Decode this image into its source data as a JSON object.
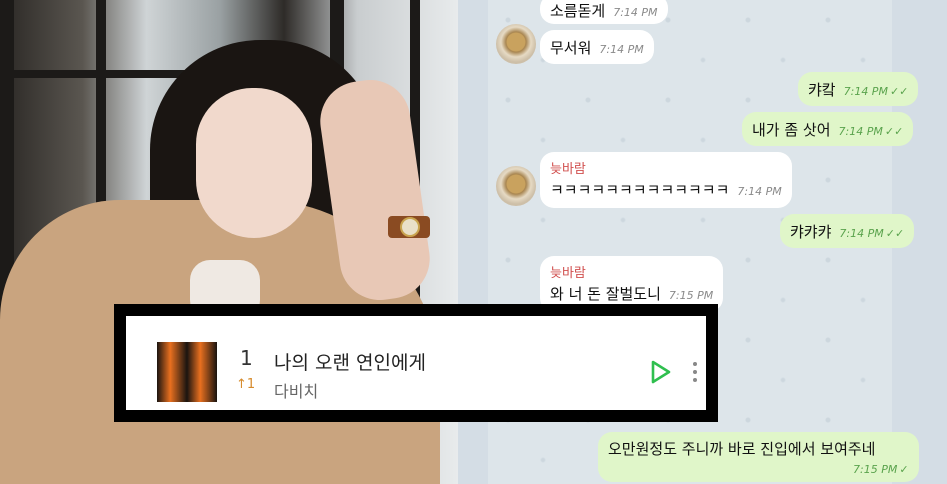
{
  "chat": {
    "messages": [
      {
        "dir": "in",
        "text": "소름돋게",
        "time": "7:14 PM"
      },
      {
        "dir": "in",
        "text": "무서워",
        "time": "7:14 PM"
      },
      {
        "dir": "out",
        "text": "캬캌",
        "time": "7:14 PM"
      },
      {
        "dir": "out",
        "text": "내가 좀 삿어",
        "time": "7:14 PM"
      },
      {
        "dir": "in",
        "sender": "늦바람",
        "text": "ㅋㅋㅋㅋㅋㅋㅋㅋㅋㅋㅋㅋㅋ",
        "time": "7:14 PM"
      },
      {
        "dir": "out",
        "text": "캬캬캬",
        "time": "7:14 PM"
      },
      {
        "dir": "in",
        "sender": "늦바람",
        "text": "와 너 돈 잘벌도니",
        "time": "7:15 PM"
      },
      {
        "dir": "out",
        "text": "오만원정도 주니까 바로 진입에서 보여주네",
        "time": "7:15 PM"
      }
    ]
  },
  "player": {
    "rank": "1",
    "rank_change": "↑1",
    "title": "나의 오랜 연인에게",
    "artist": "다비치",
    "play_icon": "play-icon",
    "more_icon": "more-vertical-icon",
    "accent": "#2fbf4f"
  }
}
